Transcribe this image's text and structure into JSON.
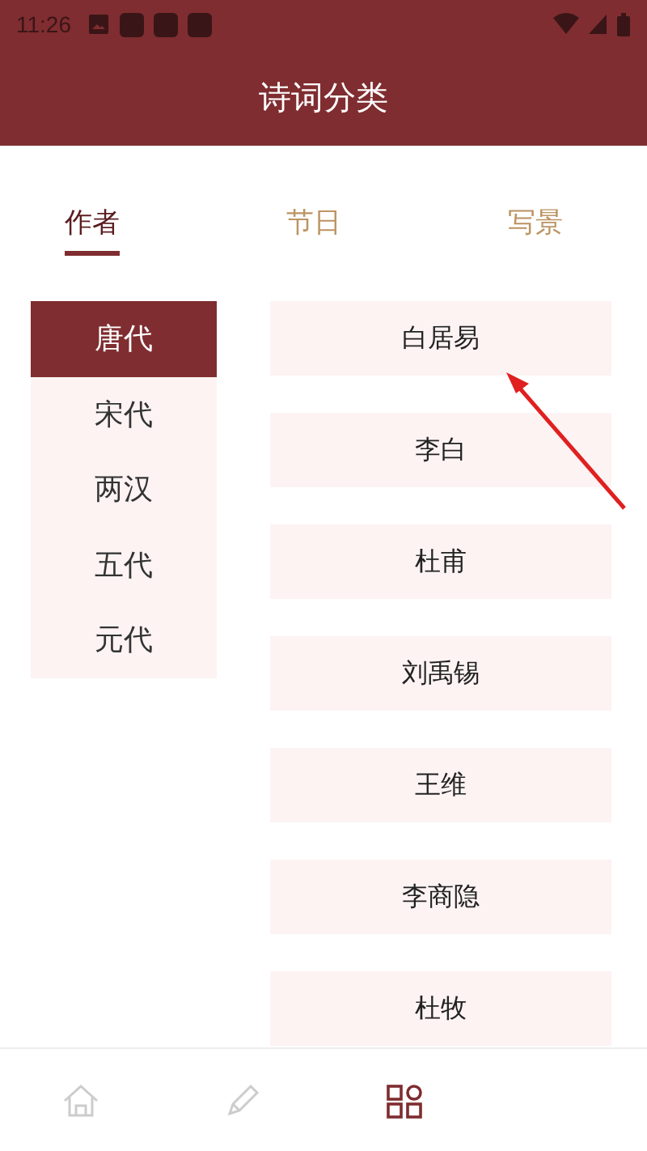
{
  "status_bar": {
    "time": "11:26"
  },
  "header": {
    "title": "诗词分类"
  },
  "tabs": [
    {
      "label": "作者",
      "selected": true
    },
    {
      "label": "节日",
      "selected": false
    },
    {
      "label": "写景",
      "selected": false
    }
  ],
  "dynasties": [
    {
      "label": "唐代",
      "selected": true
    },
    {
      "label": "宋代",
      "selected": false
    },
    {
      "label": "两汉",
      "selected": false
    },
    {
      "label": "五代",
      "selected": false
    },
    {
      "label": "元代",
      "selected": false
    }
  ],
  "authors": [
    "白居易",
    "李白",
    "杜甫",
    "刘禹锡",
    "王维",
    "李商隐",
    "杜牧"
  ],
  "bottom_nav": [
    {
      "kind": "home",
      "selected": false
    },
    {
      "kind": "pencil",
      "selected": false
    },
    {
      "kind": "grid",
      "selected": true
    }
  ]
}
